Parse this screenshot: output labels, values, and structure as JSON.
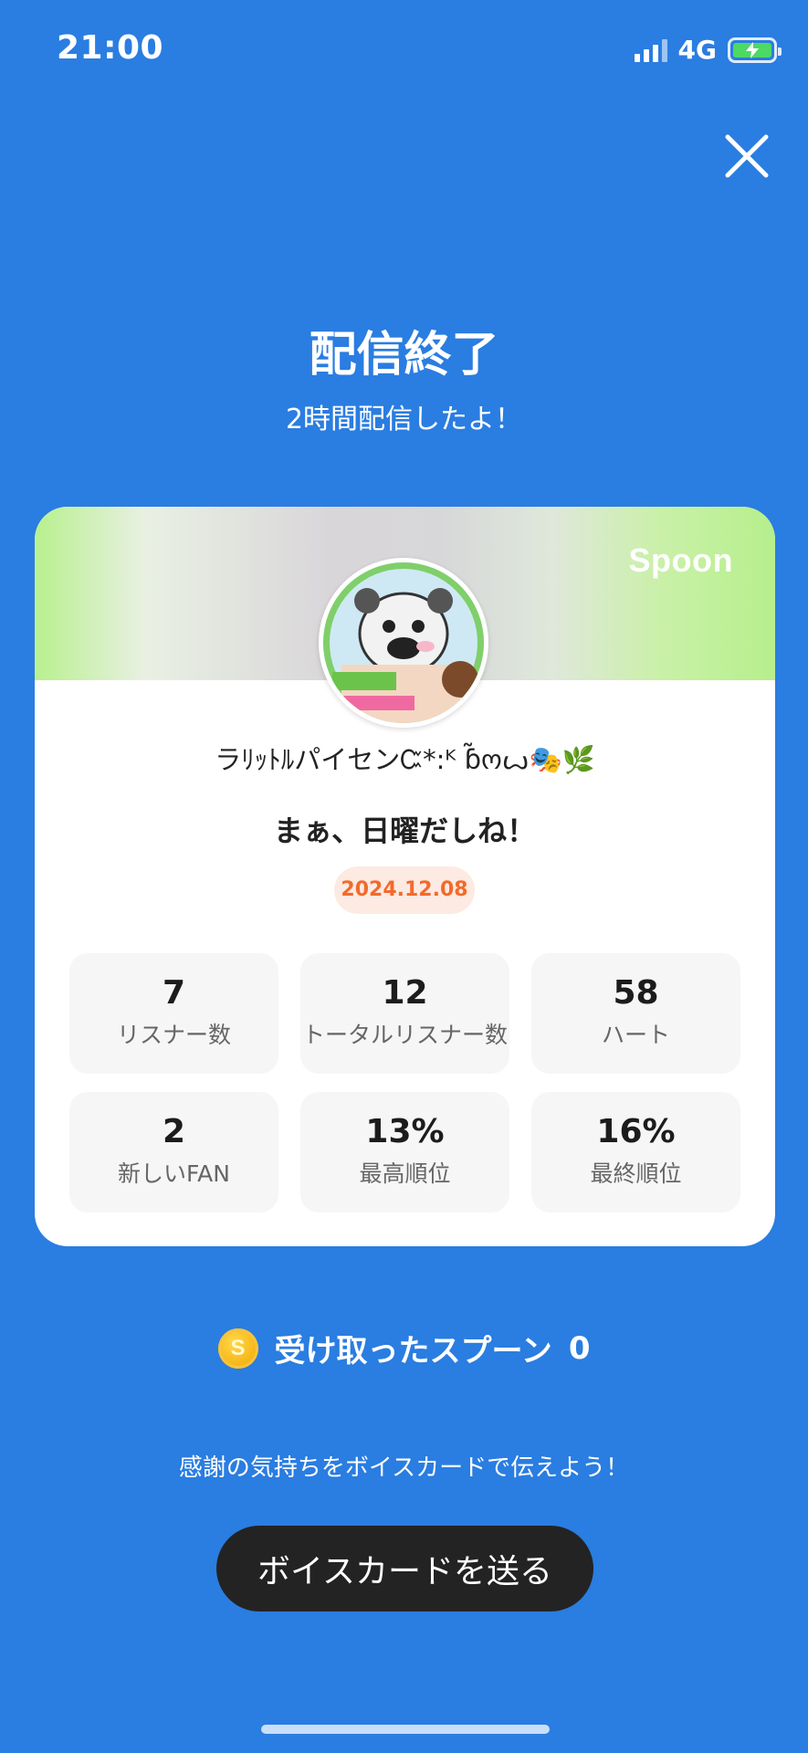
{
  "status_bar": {
    "time": "21:00",
    "network": "4G"
  },
  "header": {
    "title": "配信終了",
    "subtitle": "2時間配信したよ！"
  },
  "card": {
    "brand": "Spoon",
    "nickname": "ラﾘｯﾄﾙパイセンᏨ*:ᴷ ɓ̃ოꙍ🎭🌿",
    "live_title": "まぁ、日曜だしね！",
    "date": "2024.12.08",
    "stats": [
      {
        "value": "7",
        "label": "リスナー数"
      },
      {
        "value": "12",
        "label": "トータルリスナー数"
      },
      {
        "value": "58",
        "label": "ハート"
      },
      {
        "value": "2",
        "label": "新しいFAN"
      },
      {
        "value": "13%",
        "label": "最高順位"
      },
      {
        "value": "16%",
        "label": "最終順位"
      }
    ]
  },
  "spoons": {
    "coin_symbol": "S",
    "label": "受け取ったスプーン",
    "count": "0"
  },
  "hint": "感謝の気持ちをボイスカードで伝えよう！",
  "cta_label": "ボイスカードを送る",
  "colors": {
    "background": "#2a7de1",
    "date_accent": "#f36a2c",
    "button": "#232323"
  },
  "icons": {
    "close": "close-icon",
    "coin": "coin-icon",
    "signal": "signal-icon",
    "battery": "battery-charging-icon"
  }
}
